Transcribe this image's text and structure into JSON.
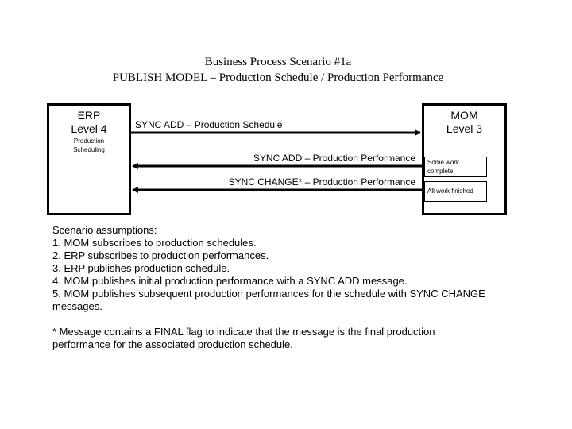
{
  "title": {
    "line1": "Business Process Scenario #1a",
    "line2": "PUBLISH MODEL – Production Schedule / Production Performance"
  },
  "erp": {
    "name": "ERP",
    "level": "Level 4",
    "function_line1": "Production",
    "function_line2": "Scheduling"
  },
  "mom": {
    "name": "MOM",
    "level": "Level 3",
    "states": [
      {
        "line1": "Some work",
        "line2": "complete"
      },
      {
        "line1": "All work finished"
      }
    ]
  },
  "messages": [
    {
      "label": "SYNC ADD – Production Schedule",
      "from": "ERP",
      "to": "MOM"
    },
    {
      "label": "SYNC ADD – Production Performance",
      "from": "MOM",
      "to": "ERP"
    },
    {
      "label": "SYNC CHANGE* – Production Performance",
      "from": "MOM",
      "to": "ERP"
    }
  ],
  "notes": {
    "heading": "Scenario assumptions:",
    "items": [
      "1. MOM subscribes to production schedules.",
      "2. ERP subscribes to production performances.",
      "3. ERP publishes production schedule.",
      "4. MOM publishes initial production performance with a SYNC ADD message.",
      "5. MOM publishes subsequent production performances for the schedule with SYNC CHANGE messages."
    ],
    "footnote": "* Message contains a FINAL flag to indicate that the message is the final production performance for the associated production schedule."
  }
}
